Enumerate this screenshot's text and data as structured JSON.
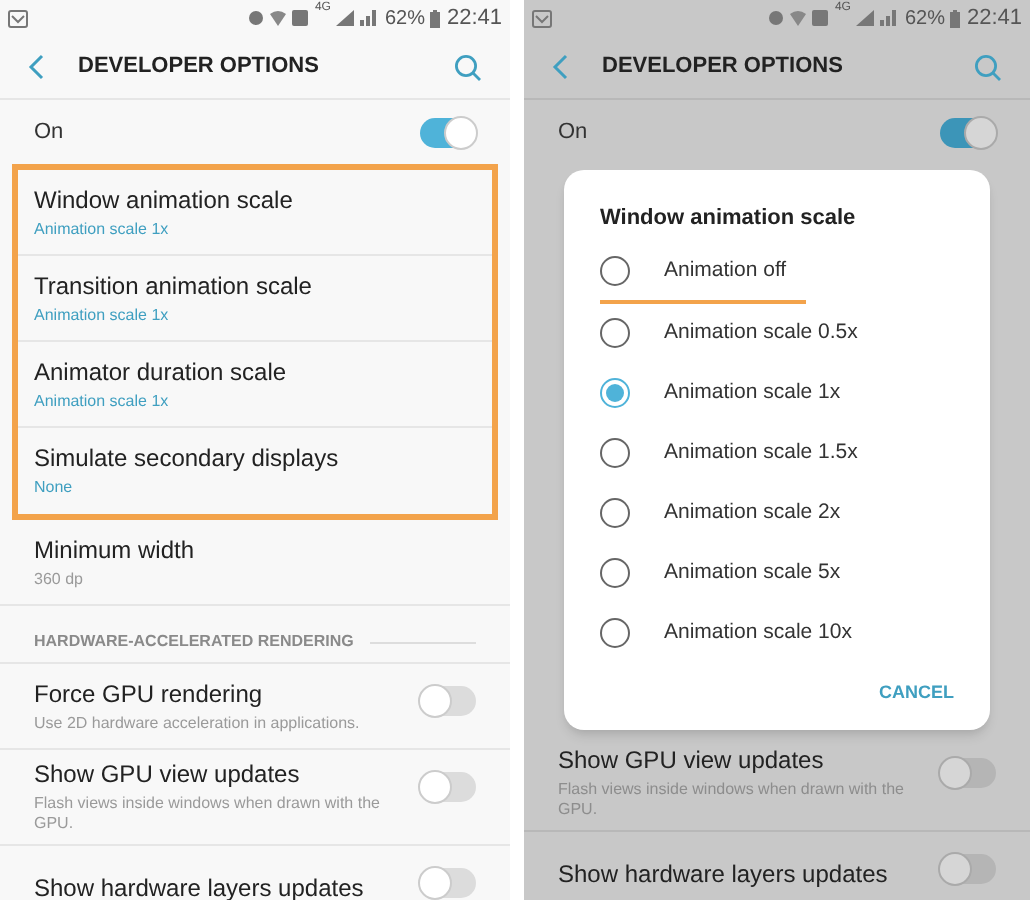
{
  "screens": [
    {
      "dimmed": false,
      "status_bar": {
        "network": "4G",
        "battery": "62%",
        "time": "22:41"
      },
      "header": {
        "title": "DEVELOPER OPTIONS"
      },
      "master": {
        "label": "On",
        "on": true
      },
      "items": [
        {
          "kind": "setting",
          "title": "Window animation scale",
          "summary": "Animation scale 1x",
          "accent": true,
          "highlighted": true
        },
        {
          "kind": "setting",
          "title": "Transition animation scale",
          "summary": "Animation scale 1x",
          "accent": true,
          "highlighted": true
        },
        {
          "kind": "setting",
          "title": "Animator duration scale",
          "summary": "Animation scale 1x",
          "accent": true,
          "highlighted": true
        },
        {
          "kind": "setting",
          "title": "Simulate secondary displays",
          "summary": "None",
          "accent": true,
          "highlighted": true
        },
        {
          "kind": "setting",
          "title": "Minimum width",
          "summary": "360 dp",
          "accent": false,
          "highlighted": false
        },
        {
          "kind": "section",
          "title": "HARDWARE-ACCELERATED RENDERING"
        },
        {
          "kind": "switch",
          "title": "Force GPU rendering",
          "summary": "Use 2D hardware acceleration in applications.",
          "on": false
        },
        {
          "kind": "switch",
          "title": "Show GPU view updates",
          "summary": "Flash views inside windows when drawn with the GPU.",
          "on": false
        },
        {
          "kind": "switch",
          "title": "Show hardware layers updates",
          "on": false
        }
      ]
    },
    {
      "dimmed": true,
      "status_bar": {
        "network": "4G",
        "battery": "62%",
        "time": "22:41"
      },
      "header": {
        "title": "DEVELOPER OPTIONS"
      },
      "master": {
        "label": "On",
        "on": true
      },
      "dialog": {
        "title": "Window animation scale",
        "options": [
          {
            "label": "Animation off",
            "selected": false,
            "underlined": true
          },
          {
            "label": "Animation scale 0.5x",
            "selected": false,
            "underlined": false
          },
          {
            "label": "Animation scale 1x",
            "selected": true,
            "underlined": false
          },
          {
            "label": "Animation scale 1.5x",
            "selected": false,
            "underlined": false
          },
          {
            "label": "Animation scale 2x",
            "selected": false,
            "underlined": false
          },
          {
            "label": "Animation scale 5x",
            "selected": false,
            "underlined": false
          },
          {
            "label": "Animation scale 10x",
            "selected": false,
            "underlined": false
          }
        ],
        "button": "CANCEL"
      },
      "items": [
        {
          "kind": "switch",
          "title": "Show GPU view updates",
          "summary": "Flash views inside windows when drawn with the GPU.",
          "on": false
        },
        {
          "kind": "switch",
          "title": "Show hardware layers updates",
          "on": false
        }
      ]
    }
  ]
}
